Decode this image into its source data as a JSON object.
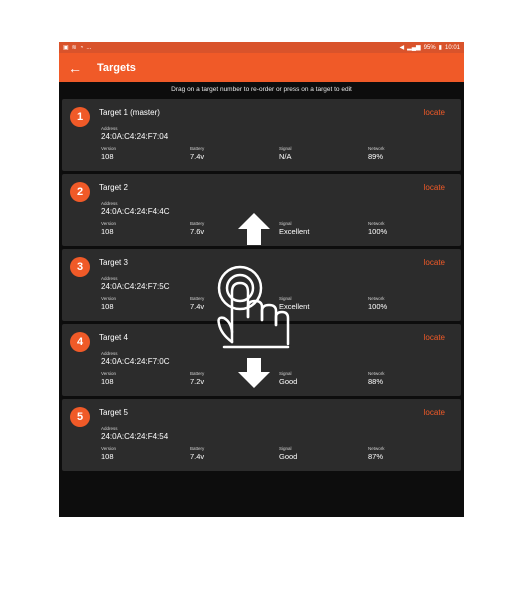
{
  "status_bar": {
    "left_icons": [
      "image-icon",
      "signal-icon",
      "wifi-icon"
    ],
    "left_text": "...",
    "battery": "95%",
    "time": "10:01"
  },
  "app_bar": {
    "title": "Targets"
  },
  "hint": "Drag on a target number to re-order or press on a target to edit",
  "labels": {
    "address": "Address",
    "version": "Version",
    "battery": "Battery",
    "signal": "Signal",
    "network": "Network",
    "locate": "locate"
  },
  "targets": [
    {
      "number": "1",
      "name": "Target 1 (master)",
      "address": "24:0A:C4:24:F7:04",
      "version": "108",
      "battery": "7.4v",
      "signal": "N/A",
      "network": "89%"
    },
    {
      "number": "2",
      "name": "Target 2",
      "address": "24:0A:C4:24:F4:4C",
      "version": "108",
      "battery": "7.6v",
      "signal": "Excellent",
      "network": "100%"
    },
    {
      "number": "3",
      "name": "Target 3",
      "address": "24:0A:C4:24:F7:5C",
      "version": "108",
      "battery": "7.4v",
      "signal": "Excellent",
      "network": "100%"
    },
    {
      "number": "4",
      "name": "Target 4",
      "address": "24:0A:C4:24:F7:0C",
      "version": "108",
      "battery": "7.2v",
      "signal": "Good",
      "network": "88%"
    },
    {
      "number": "5",
      "name": "Target 5",
      "address": "24:0A:C4:24:F4:54",
      "version": "108",
      "battery": "7.4v",
      "signal": "Good",
      "network": "87%"
    }
  ],
  "colors": {
    "accent": "#f05a28",
    "status_bar": "#d9532b",
    "card": "#2c2c2c",
    "background": "#0d0d0d"
  }
}
